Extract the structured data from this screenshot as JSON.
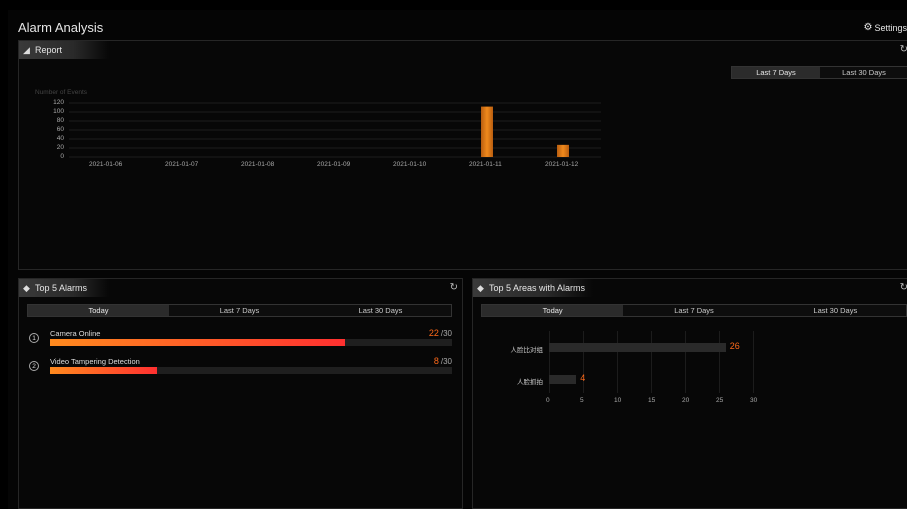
{
  "app": {
    "title": "Alarm Analysis",
    "settings_label": "Settings"
  },
  "report": {
    "title": "Report",
    "tabs": [
      "Last 7 Days",
      "Last 30 Days"
    ],
    "active_tab": 0,
    "chart_data": {
      "type": "bar",
      "ylabel": "Number of Events",
      "categories": [
        "2021-01-06",
        "2021-01-07",
        "2021-01-08",
        "2021-01-09",
        "2021-01-10",
        "2021-01-11",
        "2021-01-12"
      ],
      "values": [
        0,
        0,
        0,
        0,
        0,
        112,
        27
      ],
      "ylim": [
        0,
        120
      ],
      "yticks": [
        120,
        100,
        80,
        60,
        40,
        20,
        0
      ],
      "grid": true,
      "bar_color": "#f08a1c"
    }
  },
  "top_alarms": {
    "title": "Top 5 Alarms",
    "tabs": [
      "Today",
      "Last 7 Days",
      "Last 30 Days"
    ],
    "active_tab": 0,
    "items": [
      {
        "rank": "1",
        "name": "Camera Online",
        "count": "22",
        "total": "/30",
        "fraction": 0.7333
      },
      {
        "rank": "2",
        "name": "Video Tampering Detection",
        "count": "8",
        "total": "/30",
        "fraction": 0.2667
      }
    ]
  },
  "top_areas": {
    "title": "Top 5 Areas with Alarms",
    "tabs": [
      "Today",
      "Last 7 Days",
      "Last 30 Days"
    ],
    "active_tab": 0,
    "chart_data": {
      "type": "bar",
      "orientation": "horizontal",
      "categories": [
        "人脸比对组",
        "人脸抓拍"
      ],
      "values": [
        26,
        4
      ],
      "xlim": [
        0,
        30
      ],
      "xticks": [
        "0",
        "5",
        "10",
        "15",
        "20",
        "25",
        "30"
      ]
    }
  }
}
